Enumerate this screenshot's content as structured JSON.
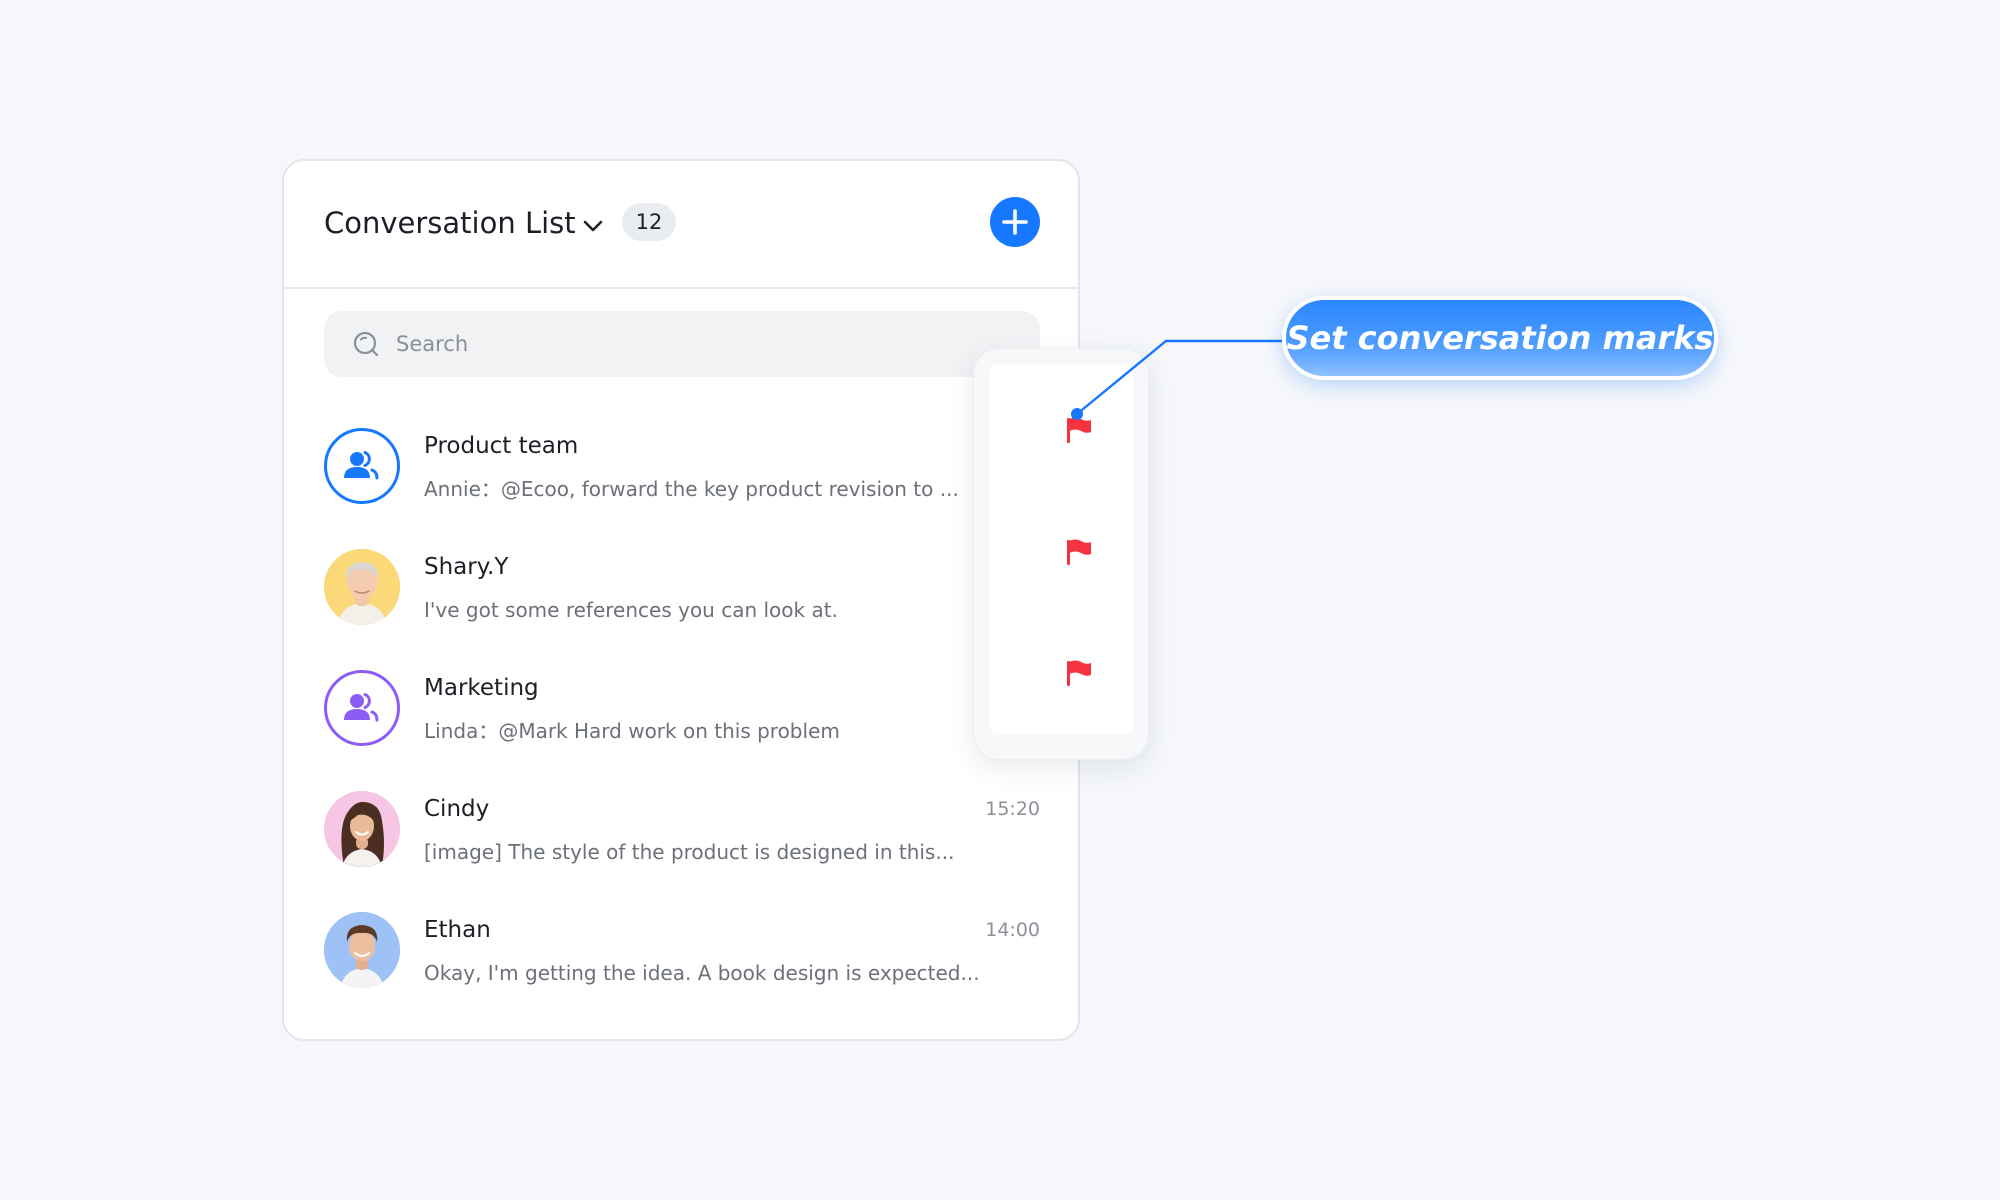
{
  "header": {
    "title": "Conversation List",
    "count": "12"
  },
  "search": {
    "placeholder": "Search"
  },
  "conversations": [
    {
      "name": "Product team",
      "preview": "Annie：@Ecoo, forward the key product revision to ...",
      "time": "",
      "avatar": "group-icon",
      "marked": true
    },
    {
      "name": "Shary.Y",
      "preview": "I've got some references you can look at.",
      "time": "",
      "avatar": "photo",
      "marked": true
    },
    {
      "name": "Marketing",
      "preview": "Linda：@Mark Hard work on this problem",
      "time": "",
      "avatar": "group-icon",
      "marked": true
    },
    {
      "name": "Cindy",
      "preview": "[image] The style of the product is designed in this...",
      "time": "15:20",
      "avatar": "photo",
      "marked": false
    },
    {
      "name": "Ethan",
      "preview": "Okay, I'm getting the idea. A book design is expected...",
      "time": "14:00",
      "avatar": "photo",
      "marked": false
    }
  ],
  "callout": {
    "label": "Set conversation marks"
  },
  "colors": {
    "accent": "#1677ff",
    "flag": "#f5333f",
    "group_blue": "#1677ff",
    "group_purple": "#8b5cf6"
  }
}
